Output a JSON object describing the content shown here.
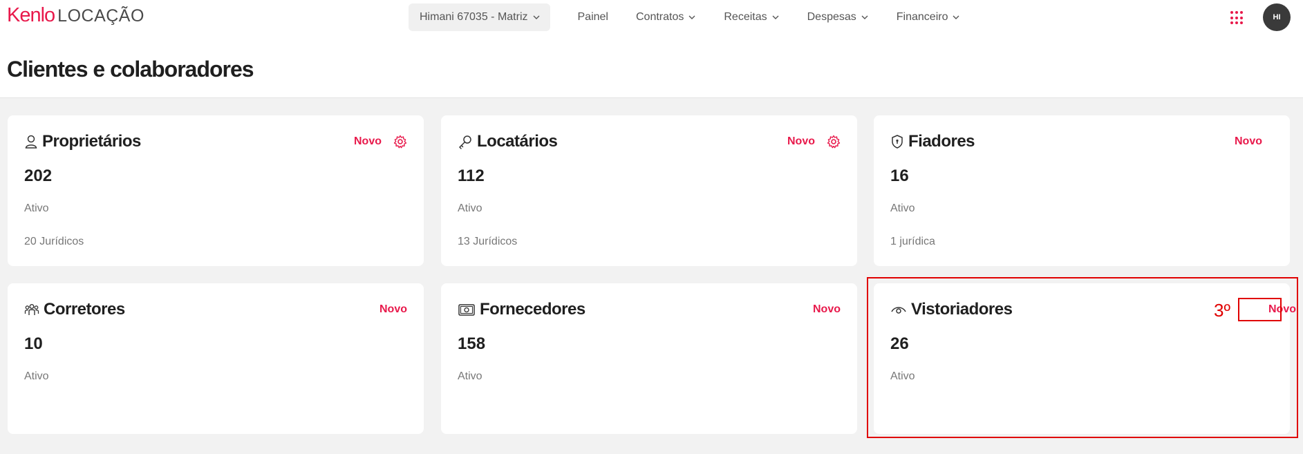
{
  "header": {
    "logo_brand": "Kenlo",
    "logo_product": "LOCAÇÃO",
    "branch_selector": "Himani 67035 - Matriz",
    "nav": [
      {
        "label": "Painel",
        "has_dropdown": false
      },
      {
        "label": "Contratos",
        "has_dropdown": true
      },
      {
        "label": "Receitas",
        "has_dropdown": true
      },
      {
        "label": "Despesas",
        "has_dropdown": true
      },
      {
        "label": "Financeiro",
        "has_dropdown": true
      }
    ],
    "apps_icon": "grid-dots-icon",
    "avatar_initials": "HI"
  },
  "page": {
    "title": "Clientes e colaboradores"
  },
  "cards": [
    {
      "title": "Proprietários",
      "icon": "user-icon",
      "new_label": "Novo",
      "has_settings": true,
      "count": "202",
      "status": "Ativo",
      "sub": "20 Jurídicos"
    },
    {
      "title": "Locatários",
      "icon": "key-icon",
      "new_label": "Novo",
      "has_settings": true,
      "count": "112",
      "status": "Ativo",
      "sub": "13 Jurídicos"
    },
    {
      "title": "Fiadores",
      "icon": "shield-icon",
      "new_label": "Novo",
      "has_settings": false,
      "count": "16",
      "status": "Ativo",
      "sub": "1 jurídica"
    },
    {
      "title": "Corretores",
      "icon": "team-icon",
      "new_label": "Novo",
      "has_settings": false,
      "count": "10",
      "status": "Ativo",
      "sub": ""
    },
    {
      "title": "Fornecedores",
      "icon": "money-icon",
      "new_label": "Novo",
      "has_settings": false,
      "count": "158",
      "status": "Ativo",
      "sub": ""
    },
    {
      "title": "Vistoriadores",
      "icon": "eye-icon",
      "new_label": "Novo",
      "has_settings": false,
      "count": "26",
      "status": "Ativo",
      "sub": ""
    }
  ],
  "annotation": {
    "step_label": "3º"
  },
  "colors": {
    "accent": "#e8194b",
    "annotation": "#e00000",
    "background": "#f2f2f2"
  }
}
